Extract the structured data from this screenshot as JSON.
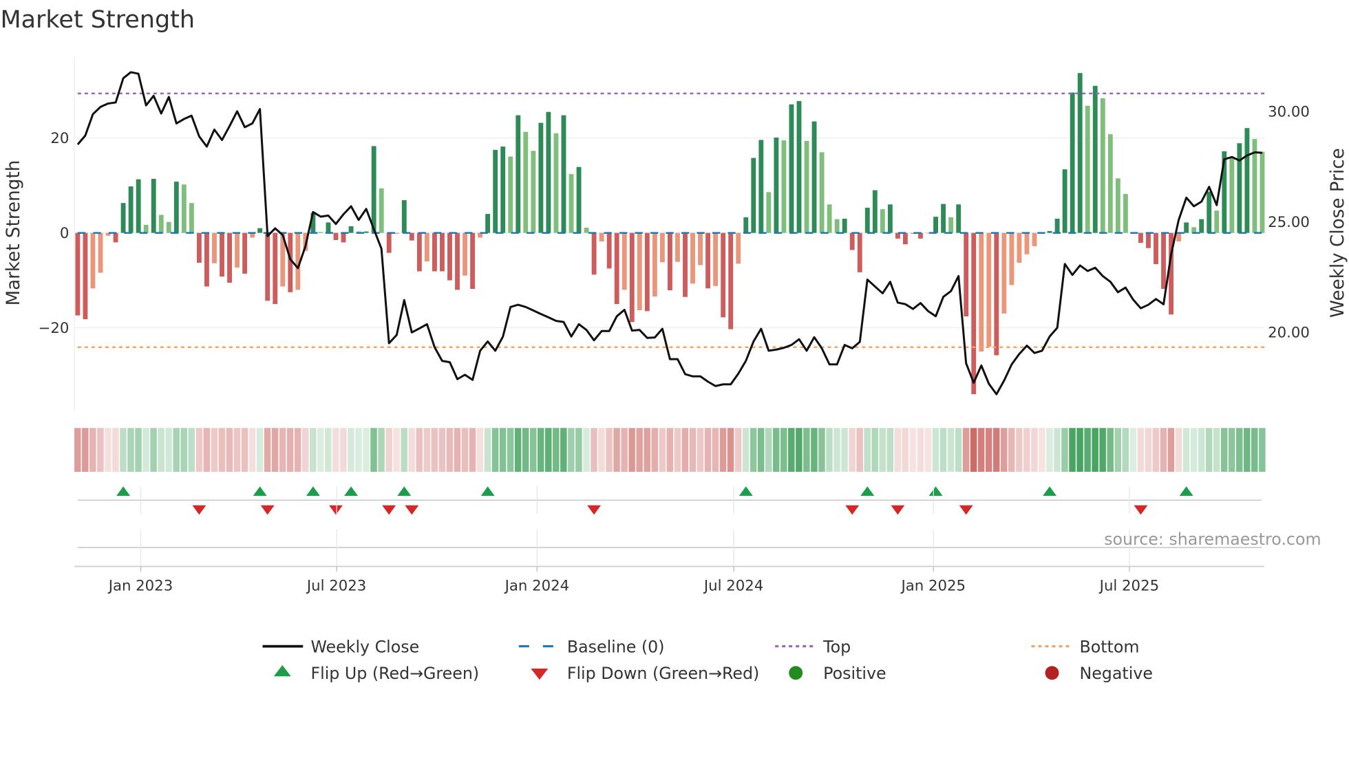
{
  "chart_data": {
    "type": "bar",
    "title": "Market Strength",
    "ylabel": "Market Strength",
    "y2label": "Weekly Close Price",
    "ylim": [
      -38,
      37
    ],
    "y2lim": [
      16.4,
      33.5
    ],
    "yticks": [
      {
        "value": 20,
        "label": "20"
      },
      {
        "value": 0,
        "label": "0"
      },
      {
        "value": -20,
        "label": "−20"
      }
    ],
    "y2ticks": [
      {
        "value": 30,
        "label": "30.00"
      },
      {
        "value": 25,
        "label": "25.00"
      },
      {
        "value": 20,
        "label": "20.00"
      }
    ],
    "xticks": [
      {
        "index": 8.3,
        "label": "Jan 2023"
      },
      {
        "index": 34.1,
        "label": "Jul 2023"
      },
      {
        "index": 60.5,
        "label": "Jan 2024"
      },
      {
        "index": 86.4,
        "label": "Jul 2024"
      },
      {
        "index": 112.7,
        "label": "Jan 2025"
      },
      {
        "index": 138.5,
        "label": "Jul 2025"
      }
    ],
    "top": 29.4,
    "bottom": -24.1,
    "baseline": 0,
    "strength": [
      -17.4,
      -18.2,
      -11.7,
      -8.4,
      -0.6,
      -2,
      6.3,
      9.8,
      11.3,
      1.7,
      11.4,
      3.8,
      2.3,
      10.8,
      10.2,
      6.3,
      -6.3,
      -11.3,
      -6.4,
      -9.2,
      -10.5,
      -7.3,
      -8.6,
      -1,
      1,
      -14.3,
      -15,
      -11.3,
      -12.5,
      -12,
      -3.8,
      4.2,
      0.2,
      2.2,
      -1.5,
      -2,
      1.4,
      0.3,
      0.3,
      18.3,
      9.4,
      -4.2,
      -0.2,
      6.9,
      -1.6,
      -8.1,
      -6,
      -8.1,
      -8.1,
      -10,
      -12,
      -9,
      -11.8,
      -1,
      4,
      17.5,
      18.2,
      16.1,
      24.8,
      21.3,
      17.3,
      23.2,
      25.5,
      21,
      24.8,
      12.4,
      13.9,
      1.1,
      -8.8,
      -1.8,
      -7.5,
      -15,
      -12,
      -18.8,
      -16.3,
      -16.5,
      -13.4,
      -6.2,
      -12.1,
      -6.1,
      -13.5,
      -10.7,
      -6.8,
      -11.7,
      -11.2,
      -17.8,
      -20.3,
      -6.5,
      3.3,
      15.8,
      19.6,
      8.6,
      20.1,
      19.5,
      27.1,
      27.8,
      19.4,
      23.5,
      17,
      6,
      2.9,
      3.0,
      -3.6,
      -8.3,
      5.3,
      9,
      5,
      6,
      -1.2,
      -2.4,
      -0.2,
      -1.2,
      -0.1,
      3.4,
      6.1,
      3.3,
      6,
      -17.6,
      -34,
      -25,
      -24,
      -25.8,
      -17,
      -11,
      -6.3,
      -4.5,
      -2.8,
      -0.1,
      0.4,
      3,
      13.4,
      29.6,
      33.7,
      26.8,
      31,
      28.4,
      20.8,
      11.5,
      8.2,
      0.1,
      -2.1,
      -3.2,
      -6.6,
      -11.8,
      -17.2,
      -1.8,
      2.2,
      1.2,
      2.9,
      8.7,
      4.7,
      17.2,
      15.9,
      18.9,
      22.1,
      19.8,
      17.1
    ],
    "weekly_close": [
      28.5,
      28.9,
      29.87,
      30.2,
      30.35,
      30.4,
      31.5,
      31.77,
      31.7,
      30.27,
      30.7,
      29.9,
      30.65,
      29.45,
      29.65,
      29.8,
      28.86,
      28.4,
      29.17,
      28.7,
      29.33,
      30,
      29.28,
      29.45,
      30.1,
      24.35,
      24.7,
      24.4,
      23.3,
      22.9,
      23.9,
      25.44,
      25.23,
      25.28,
      24.9,
      25.34,
      25.7,
      25.08,
      25.58,
      24.66,
      23.78,
      19.5,
      19.87,
      21.45,
      19.99,
      20.17,
      20.36,
      19.32,
      18.7,
      18.64,
      17.87,
      18.07,
      17.84,
      19.16,
      19.58,
      19.16,
      19.8,
      21.14,
      21.24,
      21.14,
      20.98,
      20.82,
      20.67,
      20.51,
      20.46,
      19.8,
      20.36,
      20.1,
      19.63,
      20.05,
      20.05,
      20.72,
      21.01,
      20.07,
      20.1,
      19.74,
      19.76,
      20.15,
      18.78,
      18.78,
      18.1,
      18.0,
      18.0,
      17.76,
      17.56,
      17.64,
      17.64,
      18.12,
      18.7,
      19.58,
      20.15,
      19.16,
      19.21,
      19.29,
      19.42,
      19.68,
      19.16,
      19.77,
      19.27,
      18.54,
      18.54,
      19.42,
      19.27,
      19.56,
      22.38,
      22.07,
      21.76,
      22.28,
      21.34,
      21.27,
      21.05,
      21.32,
      20.95,
      20.72,
      21.6,
      21.86,
      22.54,
      18.59,
      17.71,
      18.49,
      17.66,
      17.19,
      17.81,
      18.54,
      19.01,
      19.39,
      19.06,
      19.16,
      19.8,
      20.2,
      23.09,
      22.59,
      23.02,
      22.77,
      22.92,
      22.54,
      22.28,
      21.81,
      22.02,
      21.47,
      21.08,
      21.24,
      21.5,
      21.26,
      23.52,
      25.08,
      26.09,
      25.7,
      25.91,
      26.58,
      25.75,
      27.83,
      27.93,
      27.77,
      28.0,
      28.14,
      28.12
    ],
    "flip_up_indices": [
      6,
      24,
      31,
      36,
      43,
      54,
      88,
      104,
      113,
      128,
      146
    ],
    "flip_down_indices": [
      16,
      25,
      34,
      41,
      44,
      68,
      102,
      108,
      117,
      140
    ],
    "legend": {
      "placement": "bottom",
      "weekly_close": "Weekly Close",
      "baseline": "Baseline (0)",
      "top": "Top",
      "bottom": "Bottom",
      "flip_up": "Flip Up (Red→Green)",
      "flip_down": "Flip Down (Green→Red)",
      "positive": "Positive",
      "negative": "Negative"
    },
    "colors": {
      "green_rising": "#2e8b57",
      "green_falling": "#7fbf7b",
      "red_falling": "#cd5c5c",
      "red_rising": "#e9967a",
      "line": "#111111",
      "baseline": "#1f77b4",
      "top": "#9467bd",
      "bottom": "#f4a460",
      "flip_up": "#1a9e4a",
      "flip_down": "#d62728",
      "positive": "#228b22",
      "negative": "#b22222"
    }
  },
  "source": "source: sharemaestro.com"
}
